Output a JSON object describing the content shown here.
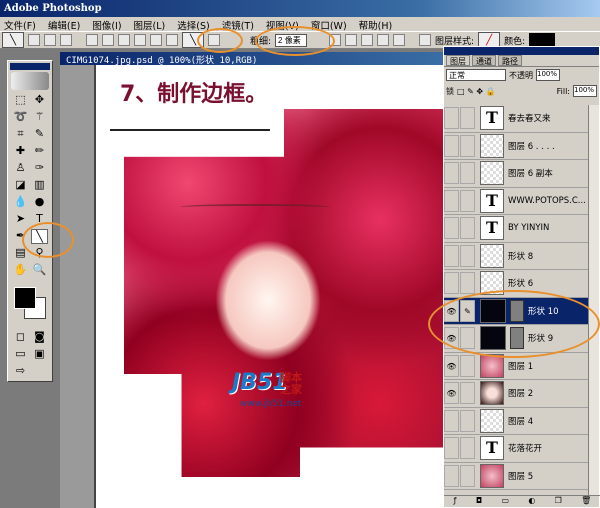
{
  "app": {
    "title": "Adobe Photoshop"
  },
  "menu": [
    "文件(F)",
    "编辑(E)",
    "图像(I)",
    "图层(L)",
    "选择(S)",
    "滤镜(T)",
    "视图(V)",
    "窗口(W)",
    "帮助(H)"
  ],
  "options": {
    "weight_label": "粗细:",
    "weight_value": "2 像素",
    "layer_style_label": "图层样式:",
    "color_label": "颜色:",
    "color": "#000000"
  },
  "document": {
    "title": "CIMG1074.jpg.psd @ 100%(形状 10,RGB)",
    "heading": "7、制作边框。"
  },
  "watermark": {
    "logo": "JB51",
    "cn": "脚本之家",
    "url": "www.jb51.net"
  },
  "layers_panel": {
    "tabs": [
      "图层",
      "通道",
      "路径"
    ],
    "blend_mode": "正常",
    "opacity_label": "不透明",
    "opacity": "100%",
    "lock_label": "锁",
    "fill_label": "Fill:",
    "fill": "100%",
    "layers": [
      {
        "name": "春去春又来",
        "type": "text",
        "visible": false
      },
      {
        "name": "图层 6 . . . .",
        "type": "pixel",
        "visible": false
      },
      {
        "name": "图层 6 副本",
        "type": "pixel",
        "visible": false
      },
      {
        "name": "WWW.POTOPS.C...",
        "type": "text",
        "visible": false
      },
      {
        "name": "BY  YINYIN",
        "type": "text",
        "visible": false
      },
      {
        "name": "形状 8",
        "type": "pixel",
        "visible": false
      },
      {
        "name": "形状 6",
        "type": "pixel",
        "visible": false
      },
      {
        "name": "形状 10",
        "type": "shape",
        "visible": true,
        "active": true
      },
      {
        "name": "形状 9",
        "type": "shape",
        "visible": true
      },
      {
        "name": "图层 1",
        "type": "photo",
        "visible": true
      },
      {
        "name": "图层 2",
        "type": "face",
        "visible": true
      },
      {
        "name": "图层 4",
        "type": "pixel",
        "visible": false
      },
      {
        "name": "花落花开",
        "type": "text",
        "visible": false
      },
      {
        "name": "图层 5",
        "type": "photo",
        "visible": false
      }
    ]
  },
  "accent": "#e8902e"
}
